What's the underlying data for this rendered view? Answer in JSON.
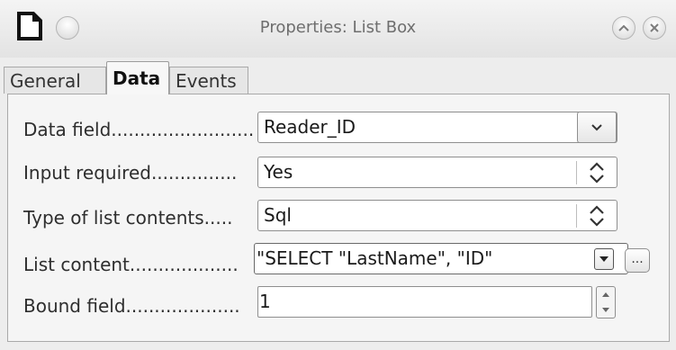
{
  "window": {
    "title": "Properties: List Box"
  },
  "tabs": [
    {
      "label": "General"
    },
    {
      "label": "Data"
    },
    {
      "label": "Events"
    }
  ],
  "form": {
    "data_field": {
      "label": "Data field.........................",
      "value": "Reader_ID"
    },
    "input_required": {
      "label": "Input required...............",
      "value": "Yes"
    },
    "type_of_list_contents": {
      "label": "Type of list contents.....",
      "value": "Sql"
    },
    "list_content": {
      "label": "List content...................",
      "value": "\"SELECT \"LastName\", \"ID\"",
      "more_label": "..."
    },
    "bound_field": {
      "label": "Bound field....................",
      "value": "1"
    }
  }
}
